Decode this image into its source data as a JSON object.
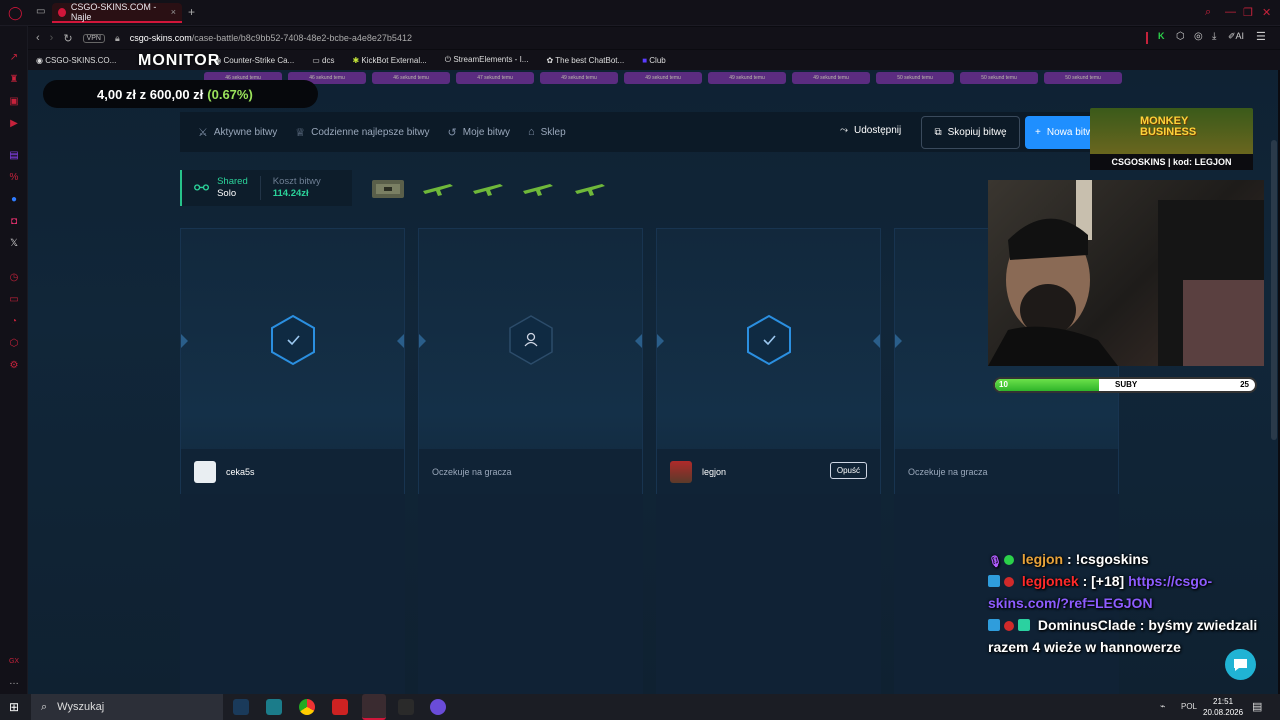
{
  "browser": {
    "tab_title": "CSGO-SKINS.COM - Najle",
    "url_domain": "csgo-skins.com",
    "url_path": "/case-battle/b8c9bb52-7408-48e2-bcbe-a4e8e27b5412",
    "vpn_label": "VPN",
    "bookmarks": [
      "CSGO-SKINS.CO...",
      "Counter-Strike Ca...",
      "dcs",
      "KickBot External...",
      "StreamElements - I...",
      "The best ChatBot...",
      "Club"
    ],
    "ai_label": "AI"
  },
  "overlay": {
    "monitor_label": "MONITOR",
    "balance_current": "4,00 zł",
    "balance_z": "z",
    "balance_total": "600,00 zł",
    "balance_pct": "(0.67%)",
    "promo_title_1": "MONKEY",
    "promo_title_2": "BUSINESS",
    "promo_code": "CSGOSKINS | kod: LEGJON",
    "sub_label": "SUBY",
    "sub_current": "10",
    "sub_goal": "25",
    "sub_fraction": 0.4
  },
  "drops": [
    "46 sekund temu",
    "46 sekund temu",
    "46 sekund temu",
    "47 sekund temu",
    "49 sekund temu",
    "49 sekund temu",
    "49 sekund temu",
    "49 sekund temu",
    "50 sekund temu",
    "50 sekund temu",
    "50 sekund temu"
  ],
  "nav": {
    "active_battles": "Aktywne bitwy",
    "daily_best": "Codzienne najlepsze bitwy",
    "my_battles": "Moje bitwy",
    "shop": "Sklep",
    "share": "Udostępnij",
    "copy_battle": "Skopiuj bitwę",
    "new_battle": "Nowa bitwa"
  },
  "battle": {
    "mode_1": "Shared",
    "mode_2": "Solo",
    "cost_label": "Koszt bitwy",
    "cost_value": "114.24zł",
    "slots": [
      {
        "player": "ceka5s",
        "status": "ready"
      },
      {
        "player": "Oczekuje na gracza",
        "status": "waiting"
      },
      {
        "player": "legjon",
        "status": "ready",
        "leave_label": "Opuść"
      },
      {
        "player": "Oczekuje na gracza",
        "status": "waiting"
      }
    ]
  },
  "chat": [
    {
      "user": "legjon",
      "color": "#e8a33a",
      "message": "!csgoskins"
    },
    {
      "user": "legjonek",
      "color": "#ff2a2a",
      "message": "[+18]",
      "link": "https://csgo-skins.com/?ref=LEGJON"
    },
    {
      "user": "DominusClade",
      "color": "#ffffff",
      "message": "byśmy zwiedzali razem 4 wieże w hannowerze"
    }
  ],
  "taskbar": {
    "search_placeholder": "Wyszukaj",
    "lang": "POL",
    "time": "21:51",
    "date": "20.08.2026"
  }
}
